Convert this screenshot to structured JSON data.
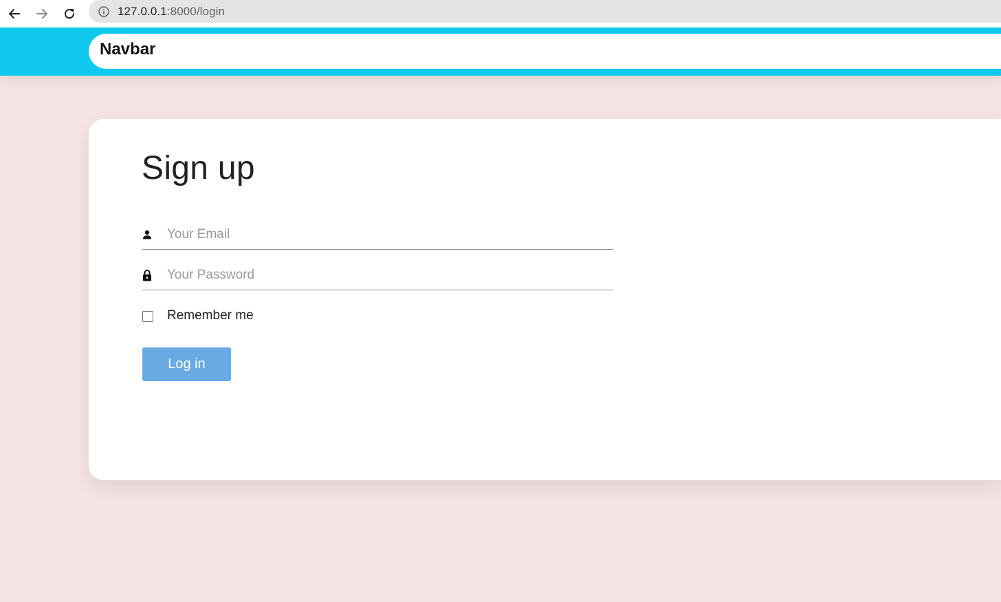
{
  "browser": {
    "url_host": "127.0.0.1",
    "url_rest": ":8000/login",
    "back_icon": "arrow-left-icon",
    "forward_icon": "arrow-right-icon",
    "reload_icon": "reload-icon",
    "info_icon": "info-icon"
  },
  "navbar": {
    "brand": "Navbar",
    "color": "#11c9ef"
  },
  "form": {
    "title": "Sign up",
    "email": {
      "placeholder": "Your Email",
      "value": "",
      "icon": "person-icon"
    },
    "password": {
      "placeholder": "Your Password",
      "value": "",
      "icon": "lock-icon"
    },
    "remember_label": "Remember me",
    "remember_checked": false,
    "submit_label": "Log in",
    "submit_color": "#6aaae4"
  },
  "colors": {
    "page_background": "#f5e3e3",
    "card_background": "#ffffff"
  }
}
